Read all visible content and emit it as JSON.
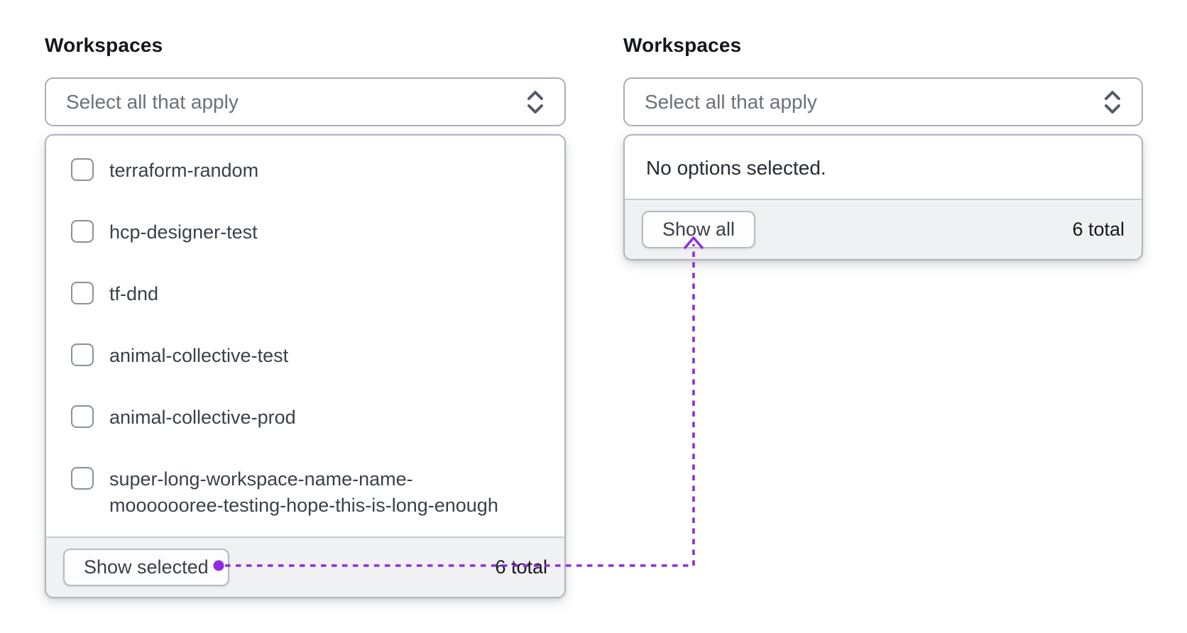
{
  "accent_color": "#8f2ce0",
  "left": {
    "label": "Workspaces",
    "select_placeholder": "Select all that apply",
    "options": [
      {
        "label": "terraform-random",
        "checked": false
      },
      {
        "label": "hcp-designer-test",
        "checked": false
      },
      {
        "label": "tf-dnd",
        "checked": false
      },
      {
        "label": "animal-collective-test",
        "checked": false
      },
      {
        "label": "animal-collective-prod",
        "checked": false
      },
      {
        "label": "super-long-workspace-name-name-mooooooree-testing-hope-this-is-long-enough",
        "checked": false
      }
    ],
    "footer": {
      "button_label": "Show selected",
      "total": "6 total"
    }
  },
  "right": {
    "label": "Workspaces",
    "select_placeholder": "Select all that apply",
    "empty_message": "No options selected.",
    "footer": {
      "button_label": "Show all",
      "total": "6 total"
    }
  }
}
